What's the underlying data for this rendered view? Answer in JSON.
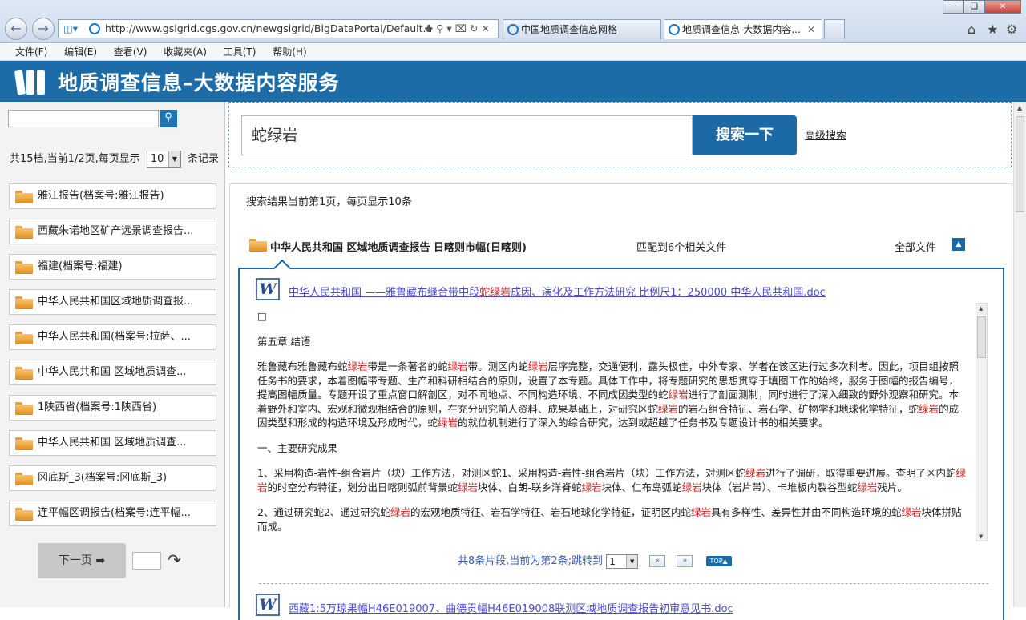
{
  "browser": {
    "url": "http://www.gsigrid.cgs.gov.cn/newgsigrid/BigDataPortal/Default.a",
    "tabs": [
      {
        "label": "中国地质调查信息网格"
      },
      {
        "label": "地质调查信息-大数据内容..."
      }
    ],
    "menu": [
      "文件(F)",
      "编辑(E)",
      "查看(V)",
      "收藏夹(A)",
      "工具(T)",
      "帮助(H)"
    ]
  },
  "site": {
    "title": "地质调查信息–大数据内容服务"
  },
  "left": {
    "search_value": "",
    "page_info_prefix": "共15档,当前1/2页,每页显示",
    "page_size": "10",
    "page_info_suffix": "条记录",
    "items": [
      {
        "label": "雅江报告(档案号:雅江报告)"
      },
      {
        "label": "西藏朱诺地区矿产远景调查报告..."
      },
      {
        "label": "福建(档案号:福建)"
      },
      {
        "label": "中华人民共和国区域地质调查报..."
      },
      {
        "label": "中华人民共和国(档案号:拉萨、..."
      },
      {
        "label": "中华人民共和国 区域地质调查..."
      },
      {
        "label": "1陕西省(档案号:1陕西省)"
      },
      {
        "label": "中华人民共和国 区域地质调查..."
      },
      {
        "label": "冈底斯_3(档案号:冈底斯_3)"
      },
      {
        "label": "连平幅区调报告(档案号:连平幅..."
      }
    ],
    "next_label": "下一页"
  },
  "search": {
    "value": "蛇绿岩",
    "button": "搜索一下",
    "advanced": "高级搜索"
  },
  "results": {
    "info": "搜索结果当前第1页，每页显示10条",
    "group_title": "中华人民共和国 区域地质调查报告 日喀则市幅(日喀则)",
    "group_match": "匹配到6个相关文件",
    "group_all": "全部文件",
    "doc1": {
      "pre": "中华人民共和国 ——雅鲁藏布缝合带中段",
      "hl": "蛇绿岩",
      "post": "成因、演化及工作方法研究 比例尺1：250000 中华人民共和国.doc"
    },
    "doc_box_char": "□",
    "chapter": "第五章 结语",
    "para1": [
      {
        "t": "雅鲁藏布雅鲁藏布蛇"
      },
      {
        "t": "绿岩",
        "h": true
      },
      {
        "t": "带是一条著名的蛇"
      },
      {
        "t": "绿岩",
        "h": true
      },
      {
        "t": "带。测区内蛇"
      },
      {
        "t": "绿岩",
        "h": true
      },
      {
        "t": "层序完整，交通便利，露头极佳，中外专家、学者在该区进行过多次科考。因此，项目组按照任务书的要求，本着图幅带专题、生产和科研相结合的原则，设置了本专题。具体工作中，将专题研究的思想贯穿于填图工作的始终，服务于图幅的报告编号，提高图幅质量。专题开设了重点窗口解剖区，对不同地点、不同构造环境、不同成因类型的蛇"
      },
      {
        "t": "绿岩",
        "h": true
      },
      {
        "t": "进行了剖面测制，同时进行了深入细致的野外观察和研究。本着野外和室内、宏观和微观相结合的原则，在充分研究前人资料、成果基础上，对研究区蛇"
      },
      {
        "t": "绿岩",
        "h": true
      },
      {
        "t": "的岩石组合特征、岩石学、矿物学和地球化学特征，蛇"
      },
      {
        "t": "绿岩",
        "h": true
      },
      {
        "t": "的成因类型和形成的构造环境及形成时代，蛇"
      },
      {
        "t": "绿岩",
        "h": true
      },
      {
        "t": "的就位机制进行了深入的综合研究，达到或超越了任务书及专题设计书的相关要求。"
      }
    ],
    "section": "一、主要研究成果",
    "para2": [
      {
        "t": "1、采用构造-岩性-组合岩片（块）工作方法，对测区蛇1、采用构造-岩性-组合岩片（块）工作方法，对测区蛇"
      },
      {
        "t": "绿岩",
        "h": true
      },
      {
        "t": "进行了调研，取得重要进展。查明了区内蛇"
      },
      {
        "t": "绿岩",
        "h": true
      },
      {
        "t": "的时空分布特征，划分出日喀则弧前背景蛇"
      },
      {
        "t": "绿岩",
        "h": true
      },
      {
        "t": "块体、白朗-联乡洋脊蛇"
      },
      {
        "t": "绿岩",
        "h": true
      },
      {
        "t": "块体、仁布岛弧蛇"
      },
      {
        "t": "绿岩",
        "h": true
      },
      {
        "t": "块体（岩片带）、卡堆板内裂谷型蛇"
      },
      {
        "t": "绿岩",
        "h": true
      },
      {
        "t": "残片。"
      }
    ],
    "para3": [
      {
        "t": "2、通过研究蛇2、通过研究蛇"
      },
      {
        "t": "绿岩",
        "h": true
      },
      {
        "t": "的宏观地质特征、岩石学特征、岩石地球化学特征，证明区内蛇"
      },
      {
        "t": "绿岩",
        "h": true
      },
      {
        "t": "具有多样性、差异性并由不同构造环境的蛇"
      },
      {
        "t": "绿岩",
        "h": true
      },
      {
        "t": "块体拼贴而成。"
      }
    ],
    "pager_text": "共8条片段,当前为第2条;跳转到",
    "pager_value": "1",
    "pager_top": "TOP",
    "doc2": {
      "title": "西藏1:5万琼果幅H46E019007、曲德贡幅H46E019008联测区域地质调查报告初审意见书.doc"
    }
  },
  "colors": {
    "brand": "#1d6ca7",
    "highlight": "#d32020",
    "link": "#4b4bd0"
  }
}
